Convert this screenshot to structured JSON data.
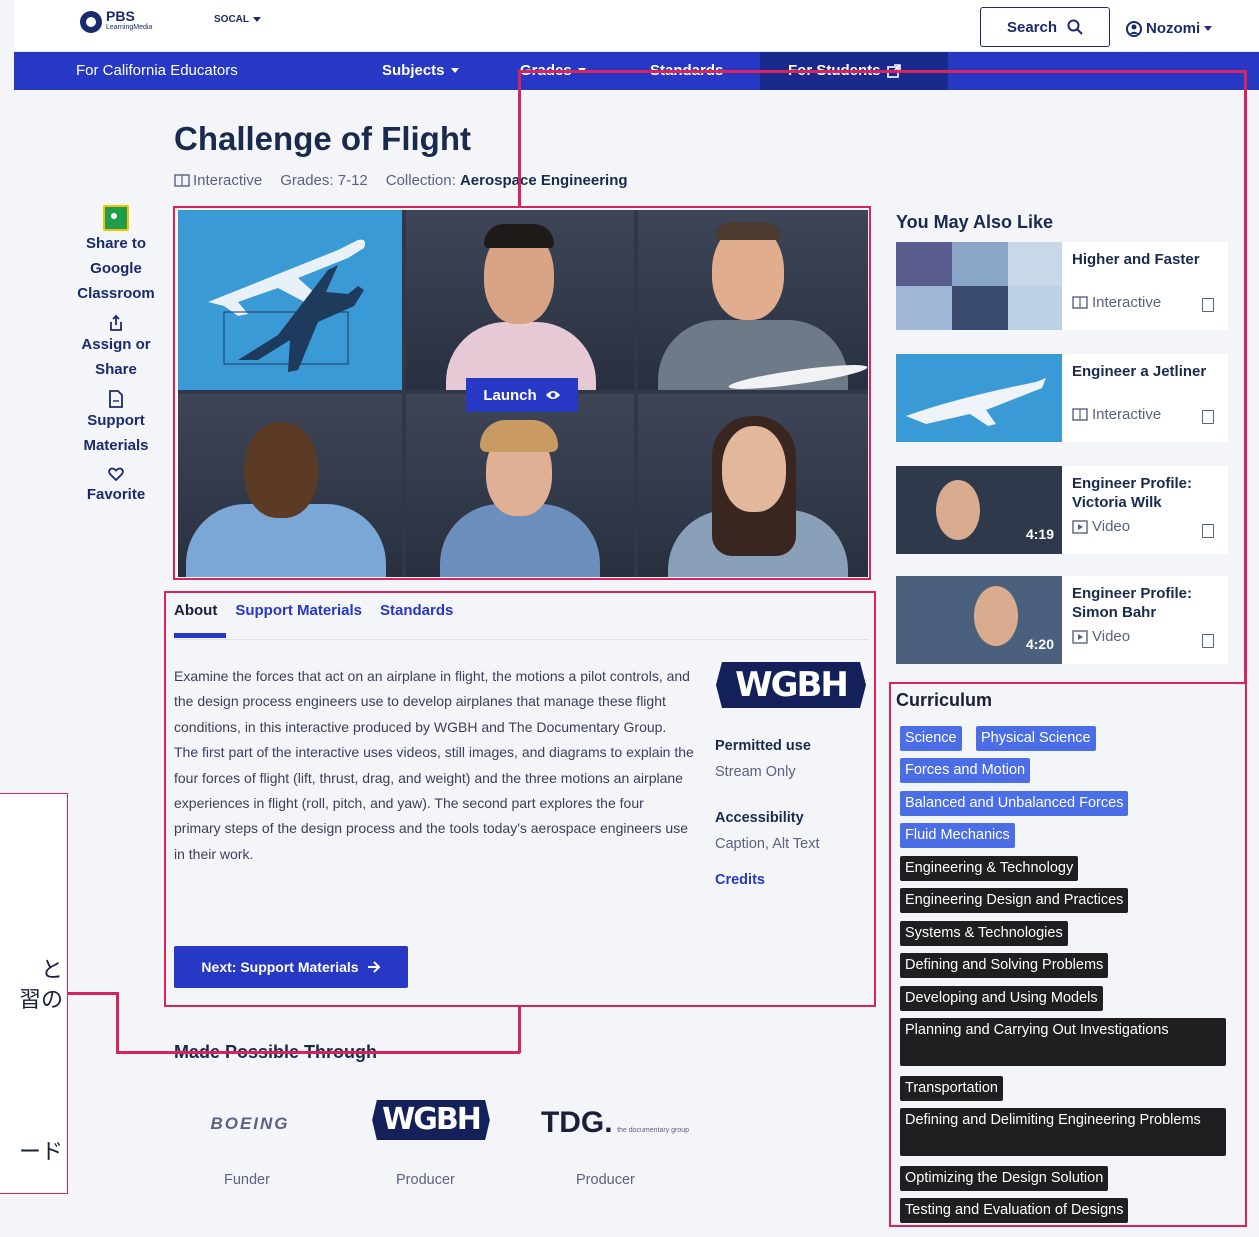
{
  "header": {
    "logo_name": "PBS",
    "logo_sub": "LearningMedia",
    "station": "SOCAL",
    "search_label": "Search",
    "user_name": "Nozomi"
  },
  "nav": {
    "region": "For California Educators",
    "items": [
      "Subjects",
      "Grades",
      "Standards",
      "For Students"
    ]
  },
  "resource": {
    "title": "Challenge of Flight",
    "type": "Interactive",
    "grades": "Grades: 7-12",
    "collection_label": "Collection:",
    "collection": "Aerospace Engineering",
    "launch_label": "Launch"
  },
  "sidebar": {
    "share": "Share to Google Classroom",
    "assign": "Assign or Share",
    "support": "Support Materials",
    "favorite": "Favorite"
  },
  "tabs": [
    "About",
    "Support Materials",
    "Standards"
  ],
  "about": {
    "description": "Examine the forces that act on an airplane in flight, the motions a pilot controls, and the design process engineers use to develop airplanes that manage these flight conditions, in this interactive produced by WGBH and The Documentary Group. The first part of the interactive uses videos, still images, and diagrams to explain the four forces of flight (lift, thrust, drag, and weight) and the three motions an airplane experiences in flight (roll, pitch, and yaw). The second part explores the four primary steps of the design process and the tools today's aerospace engineers use in their work.",
    "logo": "WGBH",
    "permitted_use_label": "Permitted use",
    "permitted_use": "Stream Only",
    "accessibility_label": "Accessibility",
    "accessibility": "Caption, Alt Text",
    "credits": "Credits",
    "next_button": "Next: Support Materials"
  },
  "sponsors": {
    "heading": "Made Possible Through",
    "items": [
      {
        "name": "BOEING",
        "role": "Funder"
      },
      {
        "name": "WGBH",
        "role": "Producer"
      },
      {
        "name": "TDG.",
        "sub": "the documentary group",
        "role": "Producer"
      }
    ]
  },
  "related": {
    "heading": "You May Also Like",
    "items": [
      {
        "title": "Higher and Faster",
        "type": "Interactive"
      },
      {
        "title": "Engineer a Jetliner",
        "type": "Interactive"
      },
      {
        "title": "Engineer Profile: Victoria Wilk",
        "type": "Video",
        "duration": "4:19"
      },
      {
        "title": "Engineer Profile: Simon Bahr",
        "type": "Video",
        "duration": "4:20"
      }
    ]
  },
  "curriculum": {
    "heading": "Curriculum",
    "tags": [
      "Science",
      "Physical Science",
      "Forces and Motion",
      "Balanced and Unbalanced Forces",
      "Fluid Mechanics",
      "Engineering & Technology",
      "Engineering Design and Practices",
      "Systems & Technologies",
      "Defining and Solving Problems",
      "Developing and Using Models",
      "Planning and Carrying Out Investigations",
      "Transportation",
      "Defining and Delimiting Engineering Problems",
      "Optimizing the Design Solution",
      "Testing and Evaluation of Designs"
    ]
  },
  "annotation": {
    "glyph_1": "と",
    "glyph_2": "習の",
    "glyph_3": "ード"
  },
  "colors": {
    "nav_blue": "#2638c4",
    "tag_blue": "#4b6ee6",
    "tag_dark": "#1f1f22",
    "annotation_red": "#d8235c"
  }
}
